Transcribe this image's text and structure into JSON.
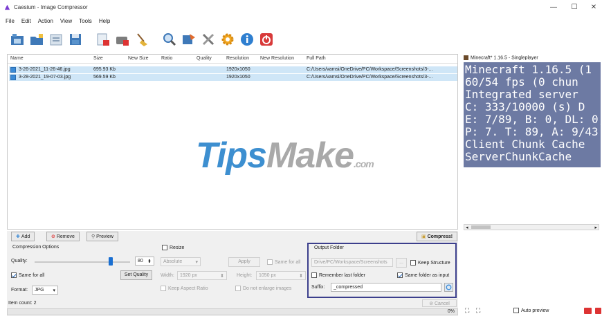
{
  "window": {
    "title": "Caesium - Image Compressor",
    "minimize": "—",
    "maximize": "☐",
    "close": "✕"
  },
  "menu": [
    "File",
    "Edit",
    "Action",
    "View",
    "Tools",
    "Help"
  ],
  "toolbar": {
    "icons": [
      "add-picture-icon",
      "add-folder-icon",
      "open-list-icon",
      "save-list-icon",
      "remove-items-icon",
      "remove-all-icon",
      "clear-list-icon",
      "search-icon",
      "compress-options-icon",
      "settings-tools-icon",
      "preferences-gear-icon",
      "info-icon",
      "power-exit-icon"
    ]
  },
  "list": {
    "columns": [
      "Name",
      "Size",
      "New Size",
      "Ratio",
      "Quality",
      "Resolution",
      "New Resolution",
      "Full Path"
    ],
    "rows": [
      {
        "name": "3-26-2021_11-26-46.jpg",
        "size": "695.93 Kb",
        "new_size": "",
        "ratio": "",
        "quality": "",
        "resolution": "1920x1050",
        "new_resolution": "",
        "path": "C:/Users/vamsi/OneDrive/PC/Workspace/Screenshots/3-..."
      },
      {
        "name": "3-28-2021_19-07-03.jpg",
        "size": "569.59 Kb",
        "new_size": "",
        "ratio": "",
        "quality": "",
        "resolution": "1920x1050",
        "new_resolution": "",
        "path": "C:/Users/vamsi/OneDrive/PC/Workspace/Screenshots/3-..."
      }
    ]
  },
  "watermark": {
    "tips": "Tips",
    "make": "Make",
    "com": ".com"
  },
  "buttons": {
    "add": "Add",
    "remove": "Remove",
    "preview": "Preview",
    "compress": "Compress!"
  },
  "compression": {
    "title": "Compression Options",
    "quality_label": "Quality:",
    "quality_value": "80",
    "quality_fraction": 0.8,
    "same_for_all": "Same for all",
    "set_quality": "Set Quality",
    "format_label": "Format:",
    "format_value": "JPG"
  },
  "resize": {
    "title": "Resize",
    "mode": "Absolute",
    "apply": "Apply",
    "same_for_all": "Same for all",
    "width_label": "Width:",
    "width_value": "1920 px",
    "height_label": "Height:",
    "height_value": "1050 px",
    "keep_aspect": "Keep Aspect Ratio",
    "no_enlarge": "Do not enlarge images"
  },
  "output": {
    "title": "Output Folder",
    "folder_value": "Drive/PC/Workspace/Screenshots",
    "browse": "...",
    "keep_structure": "Keep Structure",
    "remember_last": "Remember last folder",
    "same_folder": "Same folder as input",
    "suffix_label": "Suffix:",
    "suffix_value": "_compressed"
  },
  "status": {
    "item_count": "Item count: 2",
    "cancel": "Cancel",
    "progress": "0%"
  },
  "preview": {
    "title": "Minecraft* 1.16.5 - Singleplayer",
    "lines": [
      "Minecraft 1.16.5 (1",
      "60/54 fps (0 chun",
      "Integrated server",
      "C: 333/10000 (s) D",
      "E: 7/89, B: 0, DL: 0,",
      "P: 7. T: 89, A: 9/43",
      "Client Chunk Cache",
      "ServerChunkCache"
    ],
    "auto_preview": "Auto preview"
  }
}
